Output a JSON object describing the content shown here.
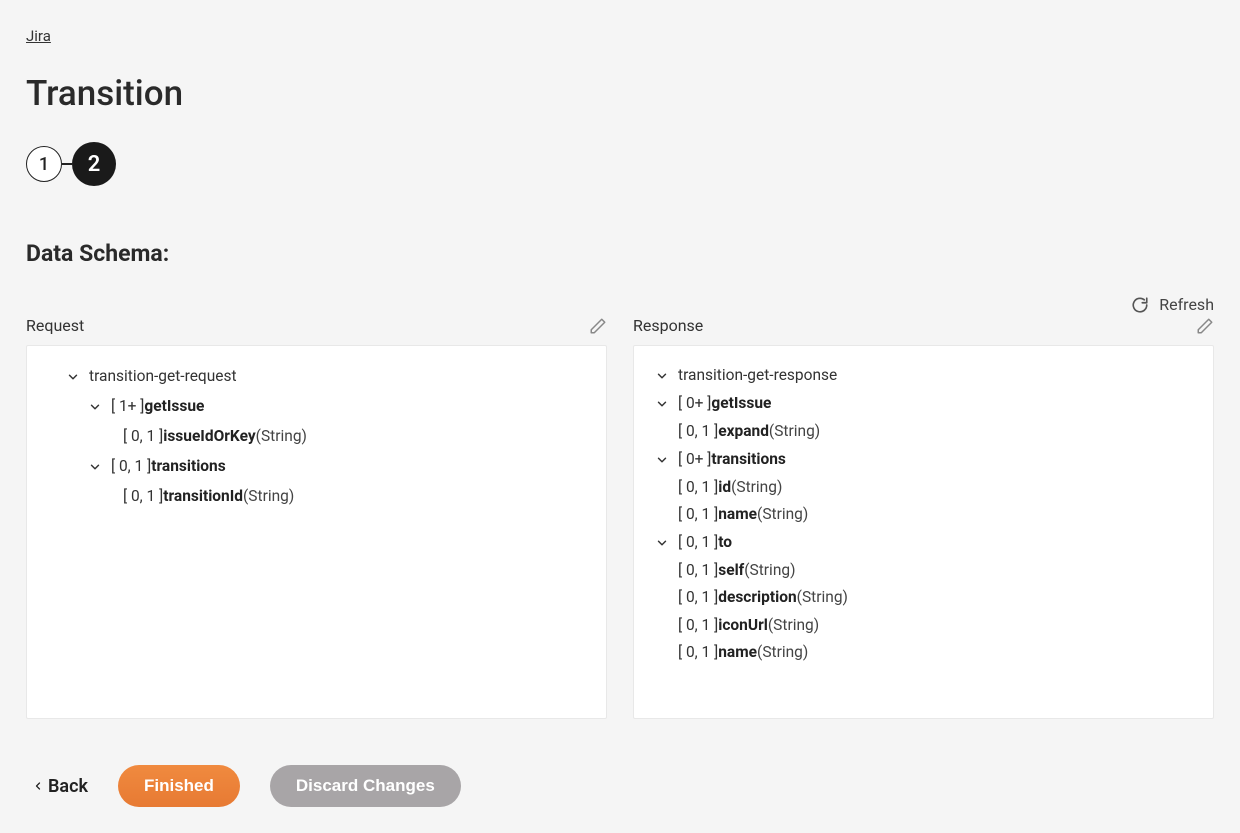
{
  "breadcrumb": "Jira",
  "title": "Transition",
  "steps": [
    "1",
    "2"
  ],
  "activeStep": 1,
  "sectionTitle": "Data Schema:",
  "refreshLabel": "Refresh",
  "request": {
    "label": "Request",
    "root": "transition-get-request",
    "tree": [
      {
        "indent": 1,
        "chev": true,
        "card": "[ 1+ ]",
        "name": "getIssue",
        "type": ""
      },
      {
        "indent": 2,
        "chev": false,
        "card": "[ 0, 1 ]",
        "name": "issueIdOrKey",
        "type": "(String)"
      },
      {
        "indent": 1,
        "chev": true,
        "card": "[ 0, 1 ]",
        "name": "transitions",
        "type": ""
      },
      {
        "indent": 2,
        "chev": false,
        "card": "[ 0, 1 ]",
        "name": "transitionId",
        "type": "(String)"
      }
    ]
  },
  "response": {
    "label": "Response",
    "root": "transition-get-response",
    "tree": [
      {
        "indent": 1,
        "chev": true,
        "card": "[ 0+ ]",
        "name": "getIssue",
        "type": ""
      },
      {
        "indent": 2,
        "chev": false,
        "card": "[ 0, 1 ]",
        "name": "expand",
        "type": "(String)"
      },
      {
        "indent": 2,
        "chev": true,
        "card": "[ 0+ ]",
        "name": "transitions",
        "type": ""
      },
      {
        "indent": 3,
        "chev": false,
        "card": "[ 0, 1 ]",
        "name": "id",
        "type": "(String)"
      },
      {
        "indent": 3,
        "chev": false,
        "card": "[ 0, 1 ]",
        "name": "name",
        "type": "(String)"
      },
      {
        "indent": 3,
        "chev": true,
        "card": "[ 0, 1 ]",
        "name": "to",
        "type": ""
      },
      {
        "indent": 4,
        "chev": false,
        "card": "[ 0, 1 ]",
        "name": "self",
        "type": "(String)"
      },
      {
        "indent": 4,
        "chev": false,
        "card": "[ 0, 1 ]",
        "name": "description",
        "type": "(String)"
      },
      {
        "indent": 4,
        "chev": false,
        "card": "[ 0, 1 ]",
        "name": "iconUrl",
        "type": "(String)"
      },
      {
        "indent": 4,
        "chev": false,
        "card": "[ 0, 1 ]",
        "name": "name",
        "type": "(String)"
      }
    ]
  },
  "footer": {
    "back": "Back",
    "finished": "Finished",
    "discard": "Discard Changes"
  }
}
